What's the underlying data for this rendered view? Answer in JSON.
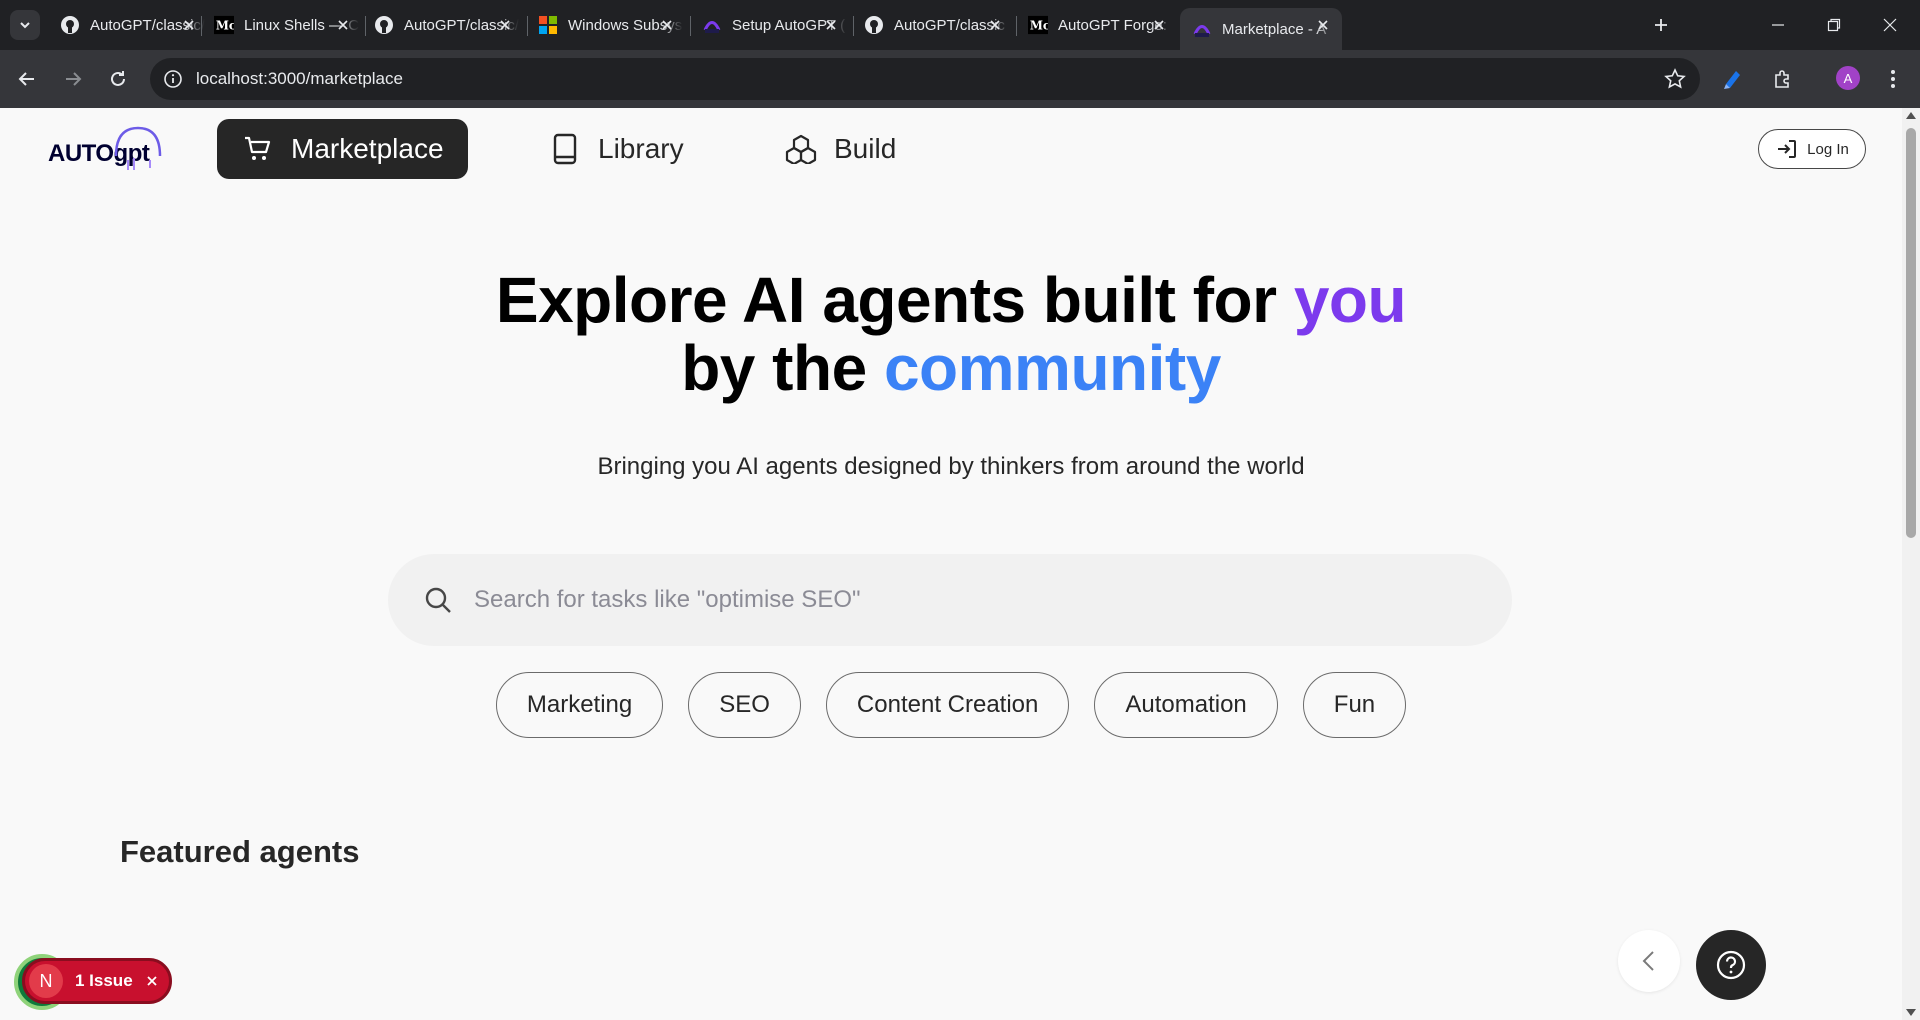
{
  "browser": {
    "tabs": [
      {
        "title": "AutoGPT/classic/",
        "icon": "github-icon"
      },
      {
        "title": "Linux Shells — C",
        "icon": "medium-icon"
      },
      {
        "title": "AutoGPT/classic/",
        "icon": "github-icon"
      },
      {
        "title": "Windows Subsys",
        "icon": "windows-icon"
      },
      {
        "title": "Setup AutoGPT (",
        "icon": "autogpt-icon"
      },
      {
        "title": "AutoGPT/classic",
        "icon": "github-icon"
      },
      {
        "title": "AutoGPT Forge:",
        "icon": "medium-icon"
      },
      {
        "title": "Marketplace - A",
        "icon": "autogpt-icon",
        "active": true
      }
    ],
    "url": "localhost:3000/marketplace",
    "profile_initial": "A"
  },
  "header": {
    "logo_text": "AUTOgpt",
    "nav": [
      {
        "label": "Marketplace",
        "icon": "cart-icon",
        "active": true
      },
      {
        "label": "Library",
        "icon": "book-icon"
      },
      {
        "label": "Build",
        "icon": "blocks-icon"
      }
    ],
    "login_label": "Log In"
  },
  "hero": {
    "line1": "Explore AI agents built for ",
    "line1_accent": "you",
    "line2": "by the ",
    "line2_accent": "community",
    "subtitle": "Bringing you AI agents designed by thinkers from around the world"
  },
  "search": {
    "placeholder": "Search for tasks like \"optimise SEO\"",
    "value": ""
  },
  "chips": [
    "Marketing",
    "SEO",
    "Content Creation",
    "Automation",
    "Fun"
  ],
  "featured": {
    "heading": "Featured agents"
  },
  "dev_overlay": {
    "initial": "N",
    "label": "1 Issue"
  },
  "colors": {
    "accent_purple": "#7c3aed",
    "accent_blue": "#3b82f6",
    "nav_active_bg": "#262626",
    "issue_red": "#c8102e"
  }
}
